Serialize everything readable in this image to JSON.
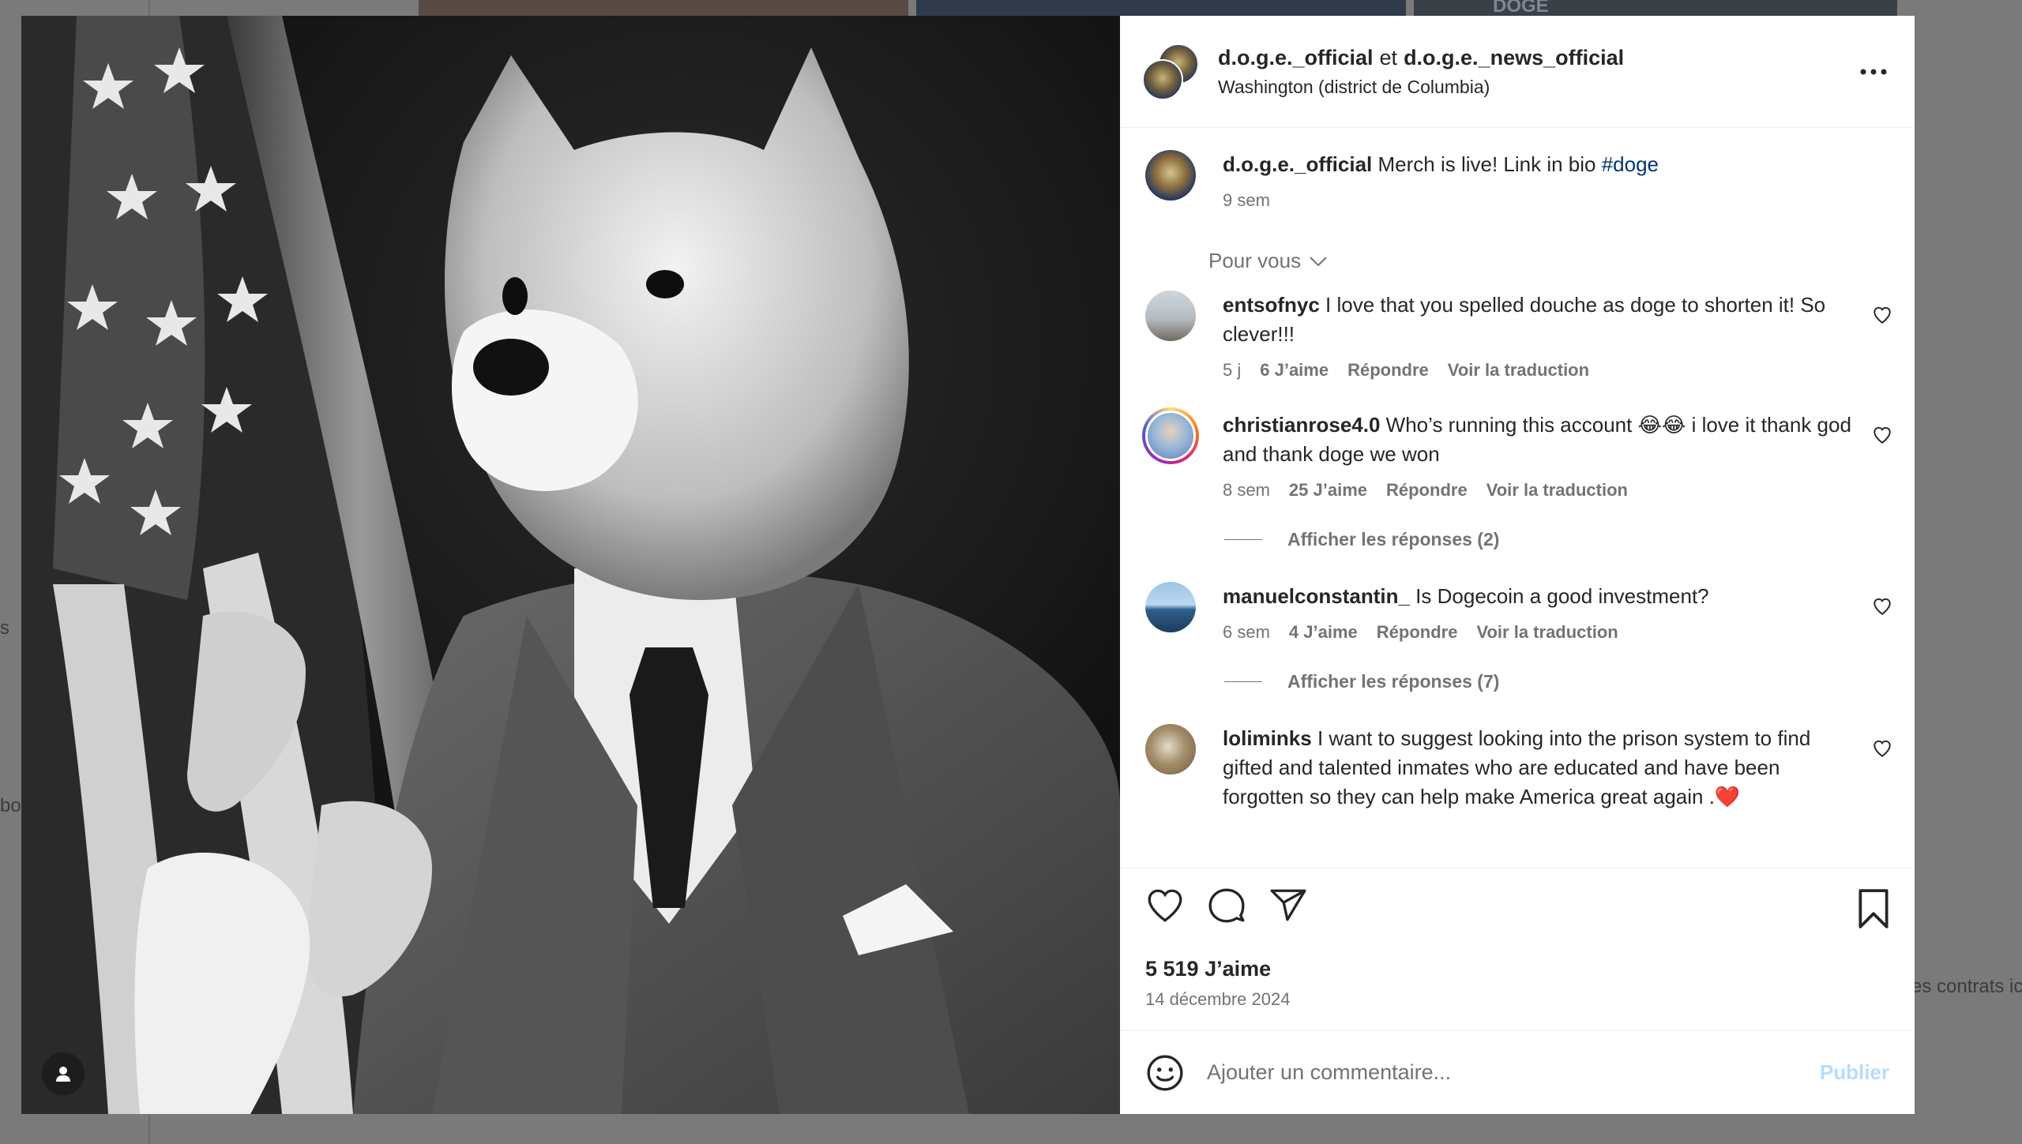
{
  "background": {
    "thumb_label": "DOGE",
    "left_fragment_1": "s",
    "left_fragment_2": "bo",
    "right_fragment": "es contrats ic"
  },
  "post": {
    "header": {
      "user1": "d.o.g.e._official",
      "connector": "et",
      "user2": "d.o.g.e._news_official",
      "location": "Washington (district de Columbia)"
    },
    "caption": {
      "username": "d.o.g.e._official",
      "text": "Merch is live! Link in bio",
      "hashtag": "#doge",
      "time": "9 sem"
    },
    "for_you_label": "Pour vous",
    "comments": [
      {
        "username": "entsofnyc",
        "text": "I love that you spelled douche as doge to shorten it! So clever!!!",
        "time": "5 j",
        "likes": "6 J’aime",
        "reply": "Répondre",
        "translate": "Voir la traduction"
      },
      {
        "username": "christianrose4.0",
        "text": "Who’s running this account 😂😂 i love it thank god and thank doge we won",
        "time": "8 sem",
        "likes": "25 J’aime",
        "reply": "Répondre",
        "translate": "Voir la traduction",
        "replies_label": "Afficher les réponses (2)"
      },
      {
        "username": "manuelconstantin_",
        "text": "Is Dogecoin a good investment?",
        "time": "6 sem",
        "likes": "4 J’aime",
        "reply": "Répondre",
        "translate": "Voir la traduction",
        "replies_label": "Afficher les réponses (7)"
      },
      {
        "username": "loliminks",
        "text": "I want to suggest looking into the prison system to find gifted and talented inmates who are educated and have been forgotten so they can help make America great again .❤️"
      }
    ],
    "likes_count": "5 519 J’aime",
    "date": "14 décembre 2024",
    "add_comment_placeholder": "Ajouter un commentaire...",
    "publish_label": "Publier"
  },
  "icons": [
    "user-tag-icon",
    "more-options-icon",
    "heart-icon",
    "comment-icon",
    "share-icon",
    "bookmark-icon",
    "emoji-icon",
    "chevron-down-icon"
  ]
}
